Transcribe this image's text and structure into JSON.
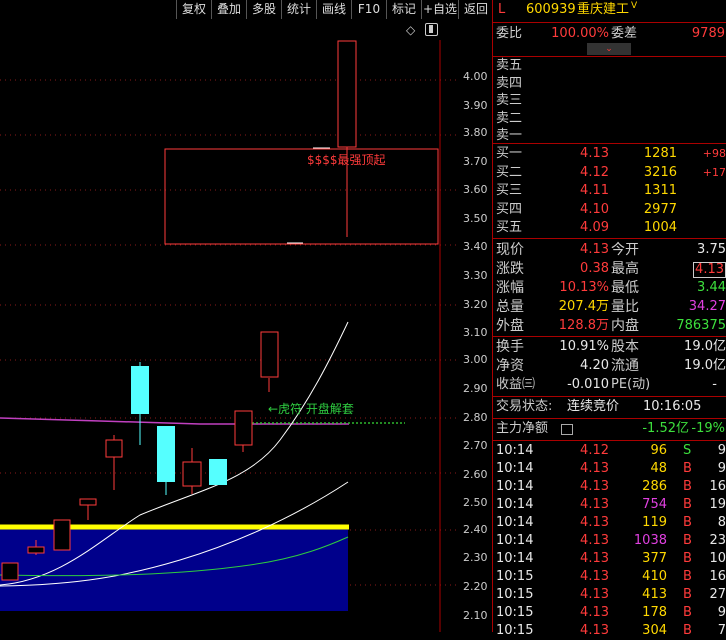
{
  "toolbar": {
    "buttons": [
      "复权",
      "叠加",
      "多股",
      "统计",
      "画线",
      "F10",
      "标记",
      "+自选",
      "返回"
    ]
  },
  "chart": {
    "y_ticks": [
      "4.00",
      "3.90",
      "3.80",
      "3.70",
      "3.60",
      "3.50",
      "3.40",
      "3.30",
      "3.20",
      "3.10",
      "3.00",
      "2.90",
      "2.80",
      "2.70",
      "2.60",
      "2.50",
      "2.40",
      "2.30",
      "2.20",
      "2.10"
    ],
    "annotation_top": "$$$$最强顶起",
    "annotation_mid": "←虎符 开盘解套",
    "settings_icon": "gear-icon",
    "diamond_icon": "diamond-icon"
  },
  "quote": {
    "flag": "L",
    "code": "600939",
    "name": "重庆建工",
    "suffix": "V",
    "weibi_label": "委比",
    "weibi_value": "100.00%",
    "weicha_label": "委差",
    "weicha_value": "9789",
    "sell_labels": [
      "卖五",
      "卖四",
      "卖三",
      "卖二",
      "卖一"
    ],
    "buy": [
      {
        "label": "买一",
        "price": "4.13",
        "vol": "1281",
        "chg": "+98"
      },
      {
        "label": "买二",
        "price": "4.12",
        "vol": "3216",
        "chg": "+17"
      },
      {
        "label": "买三",
        "price": "4.11",
        "vol": "1311",
        "chg": ""
      },
      {
        "label": "买四",
        "price": "4.10",
        "vol": "2977",
        "chg": ""
      },
      {
        "label": "买五",
        "price": "4.09",
        "vol": "1004",
        "chg": ""
      }
    ],
    "stats": [
      {
        "l1": "现价",
        "v1": "4.13",
        "c1": "red",
        "l2": "今开",
        "v2": "3.75",
        "c2": "white"
      },
      {
        "l1": "涨跌",
        "v1": "0.38",
        "c1": "red",
        "l2": "最高",
        "v2": "4.13",
        "c2": "red"
      },
      {
        "l1": "涨幅",
        "v1": "10.13%",
        "c1": "red",
        "l2": "最低",
        "v2": "3.44",
        "c2": "green"
      },
      {
        "l1": "总量",
        "v1": "207.4万",
        "c1": "yellow",
        "l2": "量比",
        "v2": "34.27",
        "c2": "purple"
      },
      {
        "l1": "外盘",
        "v1": "128.8万",
        "c1": "red",
        "l2": "内盘",
        "v2": "786375",
        "c2": "green"
      }
    ],
    "stats2": [
      {
        "l1": "换手",
        "v1": "10.91%",
        "l2": "股本",
        "v2": "19.0亿"
      },
      {
        "l1": "净资",
        "v1": "4.20",
        "l2": "流通",
        "v2": "19.0亿"
      }
    ],
    "income_label": "收益㈢",
    "income_value": "-0.010",
    "pe_label": "PE(动)",
    "pe_value": "-",
    "status_label": "交易状态:",
    "status_value": "连续竞价",
    "status_time": "10:16:05",
    "main_flow_label": "主力净额",
    "main_flow_value": "-1.52亿",
    "main_flow_pct": "-19%"
  },
  "ticks": [
    {
      "time": "10:14",
      "price": "4.12",
      "vol": "96",
      "side": "S",
      "n": "9"
    },
    {
      "time": "10:14",
      "price": "4.13",
      "vol": "48",
      "side": "B",
      "n": "9"
    },
    {
      "time": "10:14",
      "price": "4.13",
      "vol": "286",
      "side": "B",
      "n": "16"
    },
    {
      "time": "10:14",
      "price": "4.13",
      "vol": "754",
      "side": "B",
      "n": "19"
    },
    {
      "time": "10:14",
      "price": "4.13",
      "vol": "119",
      "side": "B",
      "n": "8"
    },
    {
      "time": "10:14",
      "price": "4.13",
      "vol": "1038",
      "side": "B",
      "n": "23"
    },
    {
      "time": "10:14",
      "price": "4.13",
      "vol": "377",
      "side": "B",
      "n": "10"
    },
    {
      "time": "10:15",
      "price": "4.13",
      "vol": "410",
      "side": "B",
      "n": "16"
    },
    {
      "time": "10:15",
      "price": "4.13",
      "vol": "413",
      "side": "B",
      "n": "27"
    },
    {
      "time": "10:15",
      "price": "4.13",
      "vol": "178",
      "side": "B",
      "n": "9"
    },
    {
      "time": "10:15",
      "price": "4.13",
      "vol": "304",
      "side": "B",
      "n": "7"
    }
  ]
}
